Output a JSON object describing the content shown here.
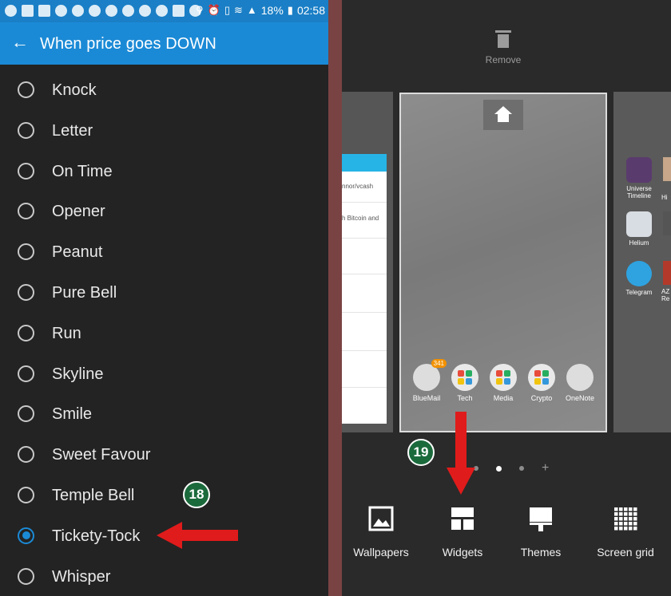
{
  "left_panel": {
    "status_bar": {
      "battery": "18%",
      "time": "02:58"
    },
    "header": {
      "title": "When price goes DOWN"
    },
    "sounds": [
      {
        "label": "Knock",
        "selected": false
      },
      {
        "label": "Letter",
        "selected": false
      },
      {
        "label": "On Time",
        "selected": false
      },
      {
        "label": "Opener",
        "selected": false
      },
      {
        "label": "Peanut",
        "selected": false
      },
      {
        "label": "Pure Bell",
        "selected": false
      },
      {
        "label": "Run",
        "selected": false
      },
      {
        "label": "Skyline",
        "selected": false
      },
      {
        "label": "Smile",
        "selected": false
      },
      {
        "label": "Sweet Favour",
        "selected": false
      },
      {
        "label": "Temple Bell",
        "selected": false
      },
      {
        "label": "Tickety-Tock",
        "selected": true
      },
      {
        "label": "Whisper",
        "selected": false
      }
    ],
    "step_badge": "18"
  },
  "right_panel": {
    "remove_label": "Remove",
    "left_page_snippets": [
      "nnor/vcash",
      "h Bitcoin and"
    ],
    "dock_apps": [
      {
        "label": "BlueMail",
        "badge": "341",
        "icon": "bluemail-icon"
      },
      {
        "label": "Tech",
        "icon": "tech-folder-icon"
      },
      {
        "label": "Media",
        "icon": "media-folder-icon"
      },
      {
        "label": "Crypto",
        "icon": "crypto-folder-icon"
      },
      {
        "label": "OneNote",
        "icon": "onenote-icon"
      }
    ],
    "right_page_apps": [
      {
        "label": "Universe Timeline",
        "icon": "universe-timeline-icon"
      },
      {
        "label": "Helium",
        "icon": "helium-icon"
      },
      {
        "label": "Telegram",
        "icon": "telegram-icon"
      }
    ],
    "right_page_edge_text": [
      "Hi",
      "AZ",
      "Re"
    ],
    "step_badge": "19",
    "toolbar": [
      {
        "label": "Wallpapers",
        "icon": "wallpapers-icon"
      },
      {
        "label": "Widgets",
        "icon": "widgets-icon"
      },
      {
        "label": "Themes",
        "icon": "themes-icon"
      },
      {
        "label": "Screen grid",
        "icon": "screen-grid-icon"
      }
    ]
  },
  "colors": {
    "header_blue": "#1b8ad6",
    "statusbar_blue": "#1a7fc6",
    "panel_dark": "#232323",
    "arrow_red": "#e01b1b",
    "badge_green": "#1b6a3c"
  }
}
